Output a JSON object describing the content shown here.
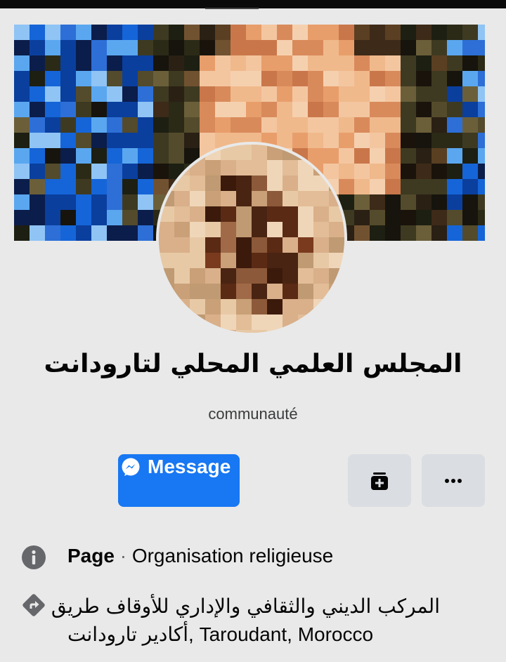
{
  "page": {
    "name": "المجلس العلمي المحلي لتارودانت",
    "category": "communauté"
  },
  "actions": {
    "message_label": "Message",
    "inbox_icon": "inbox-add-icon",
    "more_icon": "more-horizontal-icon"
  },
  "info": {
    "page_label": "Page",
    "separator": " · ",
    "page_type": "Organisation religieuse",
    "address_line1": "المركب الديني والثقافي والإداري للأوقاف طريق",
    "address_line2_ar": "أكادير تارودانت",
    "address_line2_rest": ", Taroudant, Morocco"
  },
  "colors": {
    "accent": "#1877f2",
    "background": "#e9e9e9",
    "secondary_button": "#dadde1",
    "icon_gray": "#65676b"
  }
}
